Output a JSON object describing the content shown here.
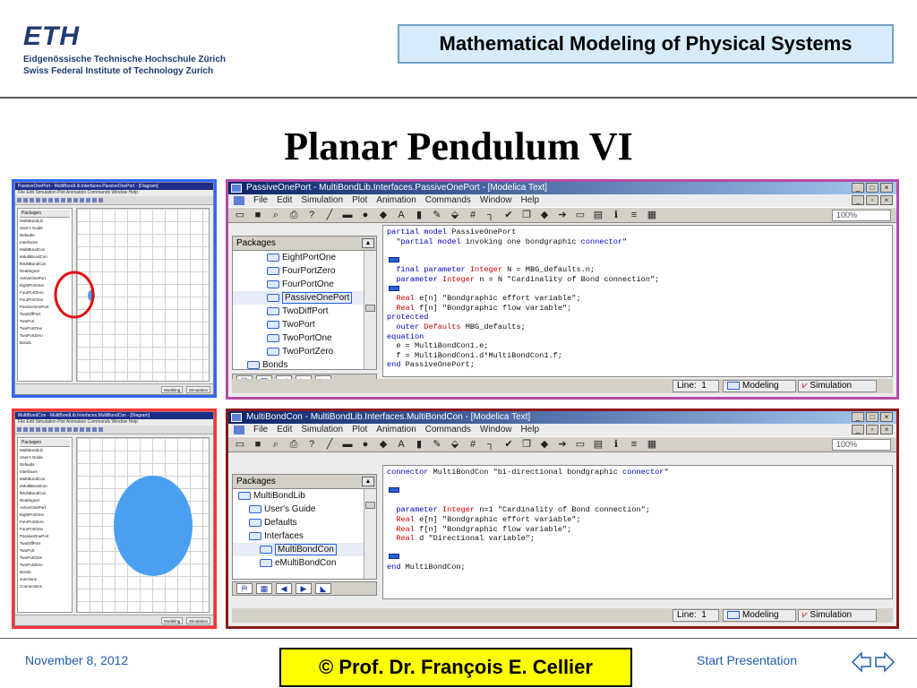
{
  "header": {
    "logo_mark": "ETH",
    "logo_line1": "Eidgenössische Technische Hochschule Zürich",
    "logo_line2": "Swiss Federal Institute of Technology Zurich",
    "course": "Mathematical Modeling of Physical Systems",
    "title": "Planar Pendulum VI"
  },
  "mini_left_top": {
    "title": "PassiveOnePort - MultiBondLib.Interfaces.PassiveOnePort - [Diagram]",
    "menu": "File  Edit  Simulation  Plot  Animation  Commands  Window  Help",
    "packages_label": "Packages",
    "tree": [
      "MultiBondLib",
      "User's Guide",
      "Defaults",
      "Interfaces",
      "MultiBondCon",
      "eMultiBondCon",
      "fMultiBondCon",
      "RealSignal",
      "ActiveOnePort",
      "EightPortOne",
      "FourPortZero",
      "FourPortOne",
      "PassiveOnePort",
      "TwoDiffPort",
      "TwoPort",
      "TwoPortOne",
      "TwoPortZero",
      "Bonds"
    ],
    "status_modeling": "Modeling",
    "status_simulation": "Simulation"
  },
  "mini_left_bottom": {
    "title": "MultiBondCon - MultiBondLib.Interfaces.MultiBondCon - [Diagram]",
    "menu": "File  Edit  Simulation  Plot  Animation  Commands  Window  Help",
    "packages_label": "Packages",
    "tree": [
      "MultiBondLib",
      "User's Guide",
      "Defaults",
      "Interfaces",
      "MultiBondCon",
      "eMultiBondCon",
      "fMultiBondCon",
      "RealSignal",
      "ActiveOnePort",
      "EightPortOne",
      "FourPortZero",
      "FourPortOne",
      "PassiveOnePort",
      "TwoDiffPort",
      "TwoPort",
      "TwoPortOne",
      "TwoPortZero",
      "Bonds",
      "Junctions",
      "Connections"
    ],
    "status_modeling": "Modeling",
    "status_simulation": "Simulation"
  },
  "window_top": {
    "title": "PassiveOnePort - MultiBondLib.Interfaces.PassiveOnePort - [Modelica Text]",
    "menu": [
      "File",
      "Edit",
      "Simulation",
      "Plot",
      "Animation",
      "Commands",
      "Window",
      "Help"
    ],
    "zoom": "100%",
    "packages_label": "Packages",
    "tree": [
      "EightPortOne",
      "FourPortZero",
      "FourPortOne",
      "PassiveOnePort",
      "TwoDiffPort",
      "TwoPort",
      "TwoPortOne",
      "TwoPortZero",
      "Bonds"
    ],
    "code": [
      "partial model PassiveOnePort",
      "  \"partial model invoking one bondgraphic connector\"",
      "",
      "",
      "  final parameter Integer N = MBG_defaults.n;",
      "  parameter Integer n = N \"Cardinality of Bond connection\";",
      "",
      "  Real e[n] \"Bondgraphic effort variable\";",
      "  Real f[n] \"Bondgraphic flow variable\";",
      "protected",
      "  outer Defaults MBG_defaults;",
      "equation",
      "  e = MultiBondCon1.e;",
      "  f = MultiBondCon1.d*MultiBondCon1.f;",
      "end PassiveOnePort;"
    ],
    "status_line_label": "Line:",
    "status_line_value": "1",
    "status_modeling": "Modeling",
    "status_simulation": "Simulation"
  },
  "window_bottom": {
    "title": "MultiBondCon - MultiBondLib.Interfaces.MultiBondCon - [Modelica Text]",
    "menu": [
      "File",
      "Edit",
      "Simulation",
      "Plot",
      "Animation",
      "Commands",
      "Window",
      "Help"
    ],
    "zoom": "100%",
    "packages_label": "Packages",
    "tree": [
      "MultiBondLib",
      "User's Guide",
      "Defaults",
      "Interfaces",
      "MultiBondCon",
      "eMultiBondCon"
    ],
    "code": [
      "connector MultiBondCon \"bi-directional bondgraphic connector\"",
      "",
      "",
      "",
      "  parameter Integer n=1 \"Cardinality of Bond connection\";",
      "  Real e[n] \"Bondgraphic effort variable\";",
      "  Real f[n] \"Bondgraphic flow variable\";",
      "  Real d \"Directional variable\";",
      "",
      "",
      "end MultiBondCon;"
    ],
    "status_line_label": "Line:",
    "status_line_value": "1",
    "status_modeling": "Modeling",
    "status_simulation": "Simulation"
  },
  "footer": {
    "date": "November 8, 2012",
    "author": "©  Prof. Dr. François E. Cellier",
    "start": "Start Presentation"
  }
}
